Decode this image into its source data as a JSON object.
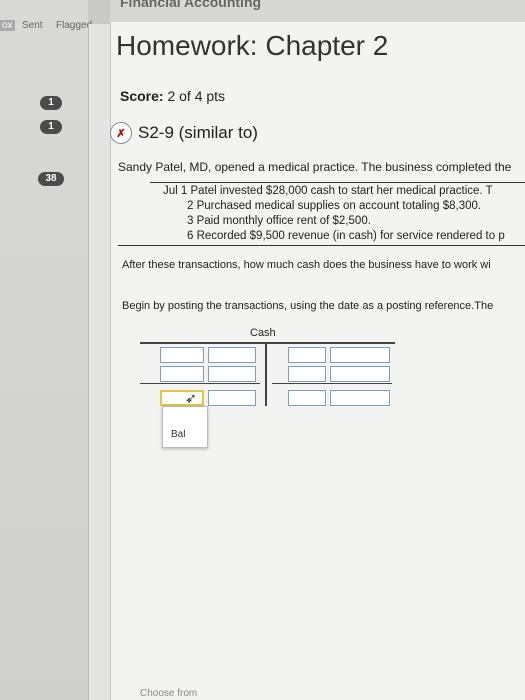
{
  "window": {
    "title": "Financial Accounting"
  },
  "mail": {
    "tabs": [
      "Sent",
      "Flagged"
    ],
    "badges": [
      "1",
      "1",
      "38"
    ]
  },
  "homework": {
    "title": "Homework: Chapter 2",
    "score_label": "Score:",
    "score_value": "2 of 4 pts",
    "question_id": "S2-9 (similar to)"
  },
  "problem": {
    "intro": "Sandy Patel, MD, opened a medical practice. The business completed the",
    "transactions": [
      "Jul 1  Patel invested $28,000 cash to start her medical practice. T",
      "2  Purchased medical supplies on account totaling $8,300.",
      "3  Paid monthly office rent of $2,500.",
      "6  Recorded $9,500 revenue (in cash) for service rendered to p"
    ],
    "question": "After these transactions, how much cash does the business have to work wi",
    "instruction": "Begin by posting the transactions, using the date as a posting reference.The"
  },
  "t_account": {
    "title": "Cash",
    "dropdown_option": "Bal"
  },
  "footer": {
    "choose": "Choose from"
  },
  "colors": {
    "badge": "#4b4b4b",
    "input_border": "#7f9db9",
    "active_border": "#e2c840"
  }
}
